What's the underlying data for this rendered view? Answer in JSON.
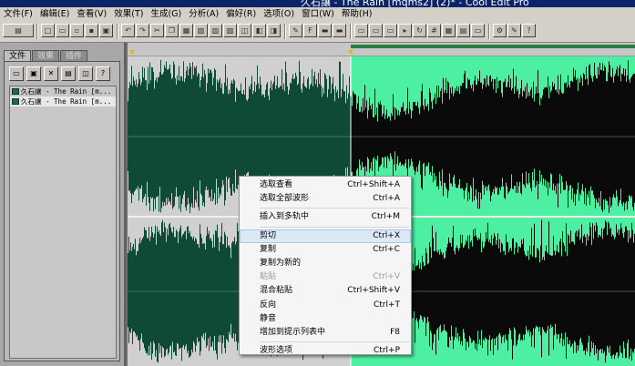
{
  "window": {
    "title": "久石讓 - The Rain [mqms2] (2)* - Cool Edit Pro"
  },
  "menubar": [
    "文件(F)",
    "编辑(E)",
    "查看(V)",
    "效果(T)",
    "生成(G)",
    "分析(A)",
    "偏好(R)",
    "选项(O)",
    "窗口(W)",
    "帮助(H)"
  ],
  "organizer": {
    "tabs": [
      "文件",
      "效果",
      "插件"
    ],
    "files": [
      "久石讓 - The Rain [m...",
      "久石讓 - The Rain [m..."
    ],
    "selected_index": 1
  },
  "waveform": {
    "unselected_color": "#0e4a35",
    "selected_bg": "#4df0a2",
    "selected_wave": "#0a0a0a",
    "selection_start_fraction": 0.44
  },
  "context_menu": {
    "items": [
      {
        "label": "选取查看",
        "shortcut": "Ctrl+Shift+A"
      },
      {
        "label": "选取全部波形",
        "shortcut": "Ctrl+A"
      },
      {
        "sep": true
      },
      {
        "label": "插入到多轨中",
        "shortcut": "Ctrl+M"
      },
      {
        "sep": true
      },
      {
        "label": "剪切",
        "shortcut": "Ctrl+X",
        "highlighted": true
      },
      {
        "label": "复制",
        "shortcut": "Ctrl+C"
      },
      {
        "label": "复制为新的",
        "shortcut": ""
      },
      {
        "label": "粘贴",
        "shortcut": "Ctrl+V",
        "disabled": true
      },
      {
        "label": "混合粘贴",
        "shortcut": "Ctrl+Shift+V"
      },
      {
        "label": "反向",
        "shortcut": "Ctrl+T"
      },
      {
        "label": "静音",
        "shortcut": ""
      },
      {
        "label": "增加到提示列表中",
        "shortcut": "F8"
      },
      {
        "sep": true
      },
      {
        "label": "波形选项",
        "shortcut": "Ctrl+P"
      }
    ]
  }
}
